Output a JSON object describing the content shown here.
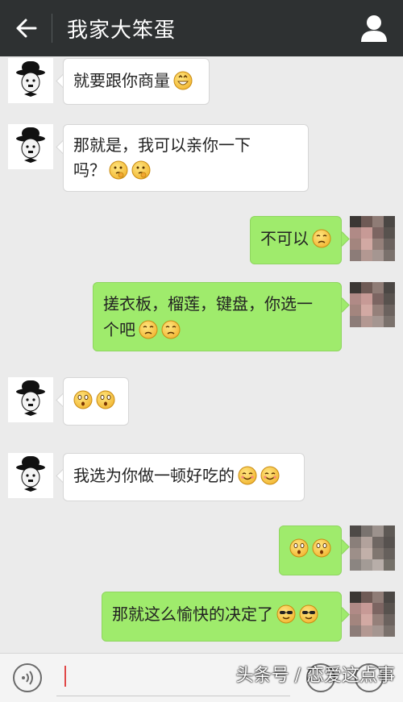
{
  "header": {
    "title": "我家大笨蛋"
  },
  "messages": [
    {
      "side": "left",
      "text": "就要跟你商量",
      "emojis": [
        "grin"
      ]
    },
    {
      "side": "left",
      "line1": "那就是，我可以亲你一下",
      "line2": "吗？",
      "emojis": [
        "thinking",
        "thinking"
      ]
    },
    {
      "side": "right",
      "text": "不可以",
      "emojis": [
        "worried"
      ]
    },
    {
      "side": "right",
      "line1": "搓衣板，榴莲，键盘，你选一",
      "line2": "个吧",
      "emojis": [
        "worried",
        "worried"
      ]
    },
    {
      "side": "left",
      "text": "",
      "emojis": [
        "shocked",
        "shocked"
      ]
    },
    {
      "side": "left",
      "text": "我选为你做一顿好吃的",
      "emojis": [
        "smile",
        "smile"
      ]
    },
    {
      "side": "right",
      "text": "",
      "emojis": [
        "shocked",
        "shocked"
      ]
    },
    {
      "side": "right",
      "text": "那就这么愉快的决定了",
      "emojis": [
        "cool",
        "cool"
      ]
    }
  ],
  "watermark": "头条号 / 恋爱这点事",
  "colors": {
    "topbar": "#2e3132",
    "right_bubble": "#9feb6c",
    "background": "#ebebeb"
  }
}
